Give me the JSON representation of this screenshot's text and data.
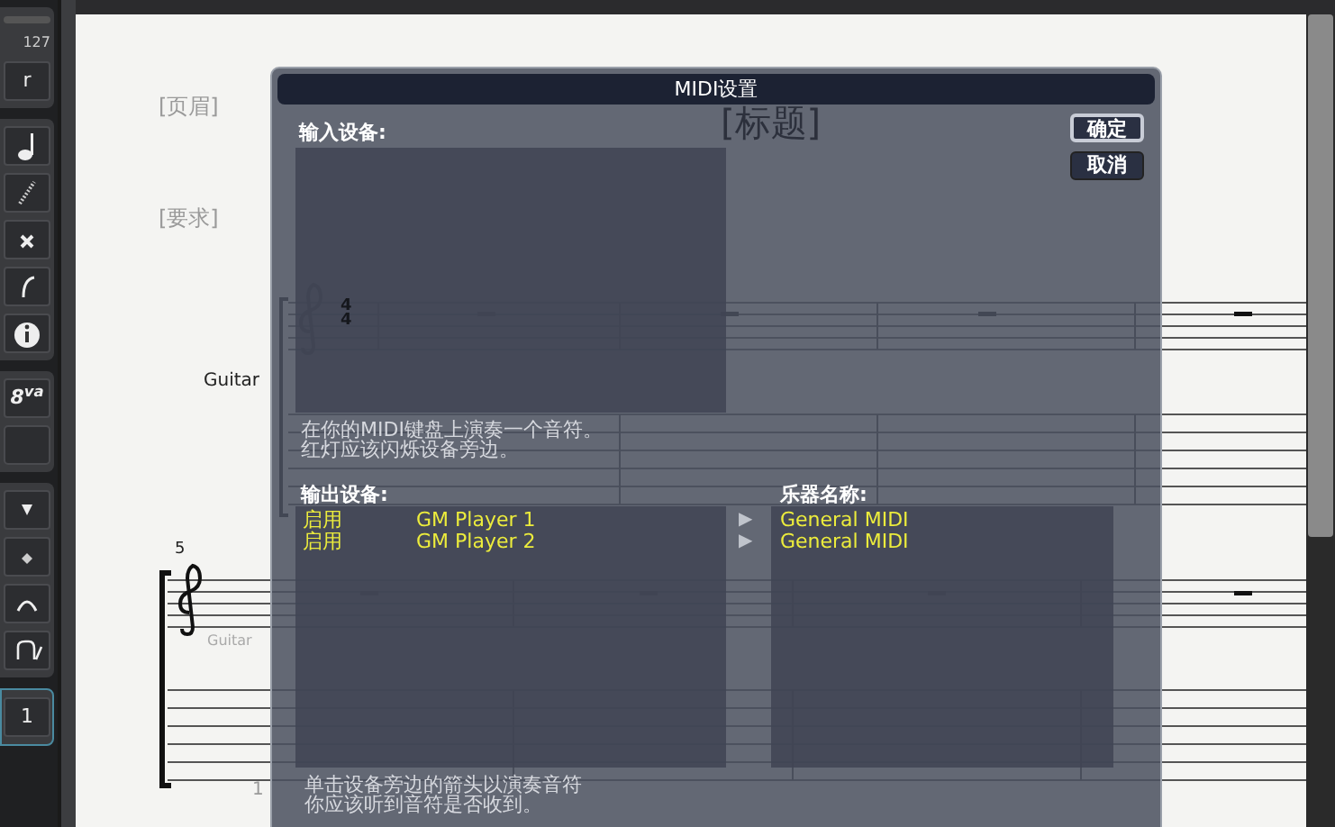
{
  "palette": {
    "velocity_max": "127",
    "cut_button": "r",
    "octave_symbol": "8$^{va}$",
    "bottom_button": "1"
  },
  "score": {
    "header": "[页眉]",
    "requirements": "[要求]",
    "title": "[标题]",
    "instrument": "Guitar",
    "time_signature": [
      "4",
      "4"
    ],
    "bar_number": "5",
    "small_instrument": "Guitar",
    "tab_number": "1"
  },
  "dialog": {
    "title": "MIDI设置",
    "input_label": "输入设备:",
    "buttons": [
      {
        "label": "确定",
        "kind": "default"
      },
      {
        "label": "取消",
        "kind": "normal"
      }
    ],
    "input_hint": [
      "在你的MIDI键盘上演奏一个音符。",
      "红灯应该闪烁设备旁边。"
    ],
    "output_label": "输出设备:",
    "instrument_label": "乐器名称:",
    "outputs": [
      {
        "status": "启用",
        "device": "GM Player 1",
        "arrow": "▶",
        "instrument": "General MIDI"
      },
      {
        "status": "启用",
        "device": "GM Player 2",
        "arrow": "▶",
        "instrument": "General MIDI"
      }
    ],
    "output_hint": [
      "单击设备旁边的箭头以演奏音符",
      "你应该听到音符是否收到。"
    ]
  }
}
